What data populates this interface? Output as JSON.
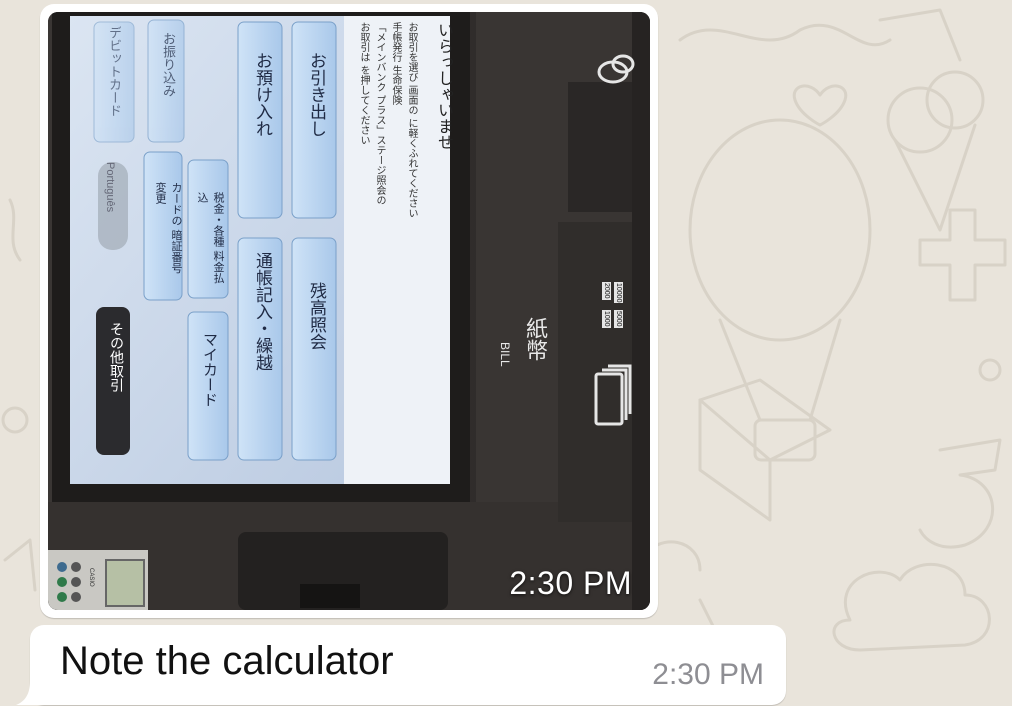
{
  "chat": {
    "image_message": {
      "timestamp": "2:30 PM",
      "atm": {
        "header_text": "いらっしゃいませ",
        "instruction_lines": [
          "お取引を選び 画面の に軽くふれてください",
          "手帳発行 生命保険",
          "「メインバンク プラス」ステージ照会の",
          "お取引は を押してください"
        ],
        "buttons": [
          {
            "label": "お引き出し"
          },
          {
            "label": "残高照会"
          },
          {
            "label": "お預け入れ"
          },
          {
            "label": "通帳記入・繰越"
          },
          {
            "label": "税金・各種 料金払込"
          },
          {
            "label": "マイカード"
          },
          {
            "label": "カードの 暗証番号変更"
          },
          {
            "label": "お振り込み"
          },
          {
            "label": "デビットカード"
          },
          {
            "label": "その他取引"
          }
        ],
        "language_option": "Português",
        "bill_label_jp": "紙幣",
        "bill_label_en": "BILL",
        "denominations": [
          "10000",
          "5000",
          "2000",
          "1000"
        ],
        "calculator_brand": "CASIO"
      }
    },
    "text_message": {
      "text": "Note the calculator",
      "timestamp": "2:30 PM"
    }
  }
}
